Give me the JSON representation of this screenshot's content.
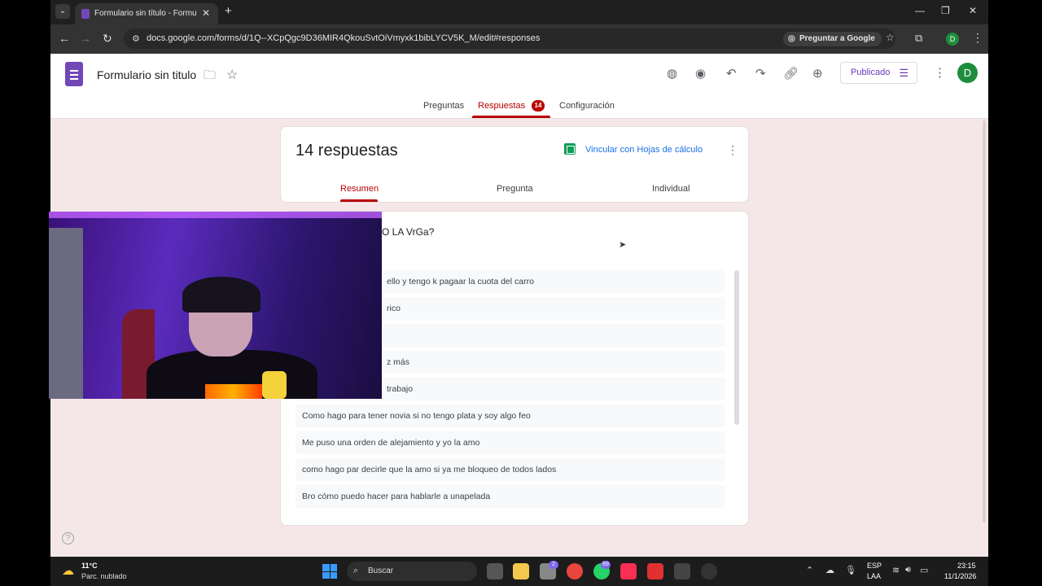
{
  "browser": {
    "tab_title": "Formulario sin título - Formular",
    "url": "docs.google.com/forms/d/1Q--XCpQgc9D36MIR4QkouSvtOiVmyxk1bibLYCV5K_M/edit#responses",
    "ask_google_label": "Preguntar a Google",
    "profile_initial": "D"
  },
  "forms_header": {
    "title": "Formulario sin titulo",
    "published_label": "Publicado",
    "avatar_initial": "D",
    "tabs": [
      {
        "label": "Preguntas"
      },
      {
        "label": "Respuestas",
        "badge": "14"
      },
      {
        "label": "Configuración"
      }
    ],
    "active_tab": "Respuestas"
  },
  "summary": {
    "count_label": "14 respuestas",
    "link_sheets_label": "Vincular con Hojas de cálculo",
    "subtabs": [
      {
        "label": "Resumen"
      },
      {
        "label": "Pregunta"
      },
      {
        "label": "Individual"
      }
    ],
    "active_subtab": "Resumen"
  },
  "question": {
    "title_visible": "O LA VrGa?",
    "answers": [
      "ello y tengo k pagaar la cuota del carro",
      "rico",
      "",
      "z más",
      "trabajo",
      "Como hago para tener novia si no tengo plata y soy algo feo",
      "Me puso una orden de alejamiento y yo la amo",
      "como hago par decirle que la amo si ya me bloqueo de todos lados",
      "Bro cómo puedo hacer para hablarle a unapelada"
    ]
  },
  "taskbar": {
    "temperature": "11°C",
    "condition": "Parc. nublado",
    "search_label": "Buscar",
    "language_line1": "ESP",
    "language_line2": "LAA",
    "time": "23:15",
    "date": "11/1/2026",
    "badges": {
      "tasks": "2",
      "whatsapp": "69"
    }
  },
  "colors": {
    "forms_purple": "#7248b9",
    "active_red": "#b80000",
    "page_bg": "#f5e6e8",
    "link_blue": "#1a73e8",
    "sheets_green": "#0f9d58"
  }
}
